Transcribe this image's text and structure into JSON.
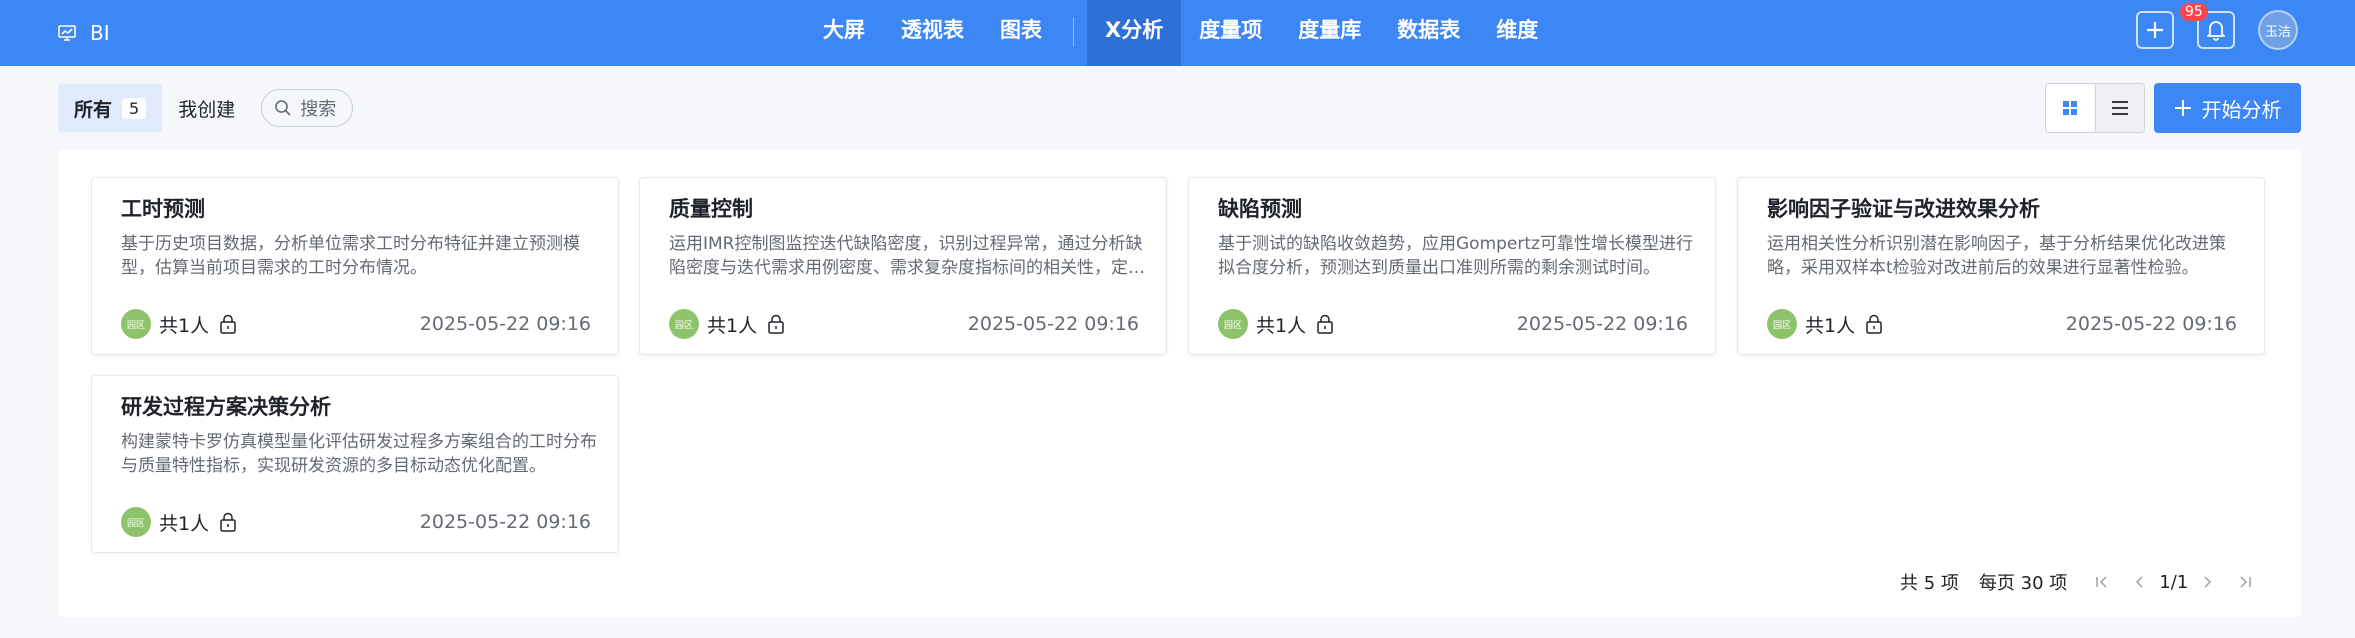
{
  "app": {
    "brand": "BI",
    "brand_icon": "monitor-chart-icon"
  },
  "nav": {
    "items": [
      {
        "label": "大屏"
      },
      {
        "label": "透视表"
      },
      {
        "label": "图表"
      },
      {
        "label": "X分析",
        "active": true
      },
      {
        "label": "度量项"
      },
      {
        "label": "度量库"
      },
      {
        "label": "数据表"
      },
      {
        "label": "维度"
      }
    ],
    "notification_count": "95",
    "user_avatar_text": "玉洁"
  },
  "filter": {
    "all_label": "所有",
    "all_count": "5",
    "mine_label": "我创建",
    "search_placeholder": "搜索"
  },
  "toolbar": {
    "start_label": "开始分析"
  },
  "cards": [
    {
      "title": "工时预测",
      "desc": "基于历史项目数据，分析单位需求工时分布特征并建立预测模型，估算当前项目需求的工时分布情况。",
      "avatar": "园区",
      "shared": "共1人",
      "date": "2025-05-22 09:16"
    },
    {
      "title": "质量控制",
      "desc": "运用IMR控制图监控迭代缺陷密度，识别过程异常，通过分析缺陷密度与迭代需求用例密度、需求复杂度指标间的相关性，定位影响质量的关键因素。",
      "avatar": "园区",
      "shared": "共1人",
      "date": "2025-05-22 09:16"
    },
    {
      "title": "缺陷预测",
      "desc": "基于测试的缺陷收敛趋势，应用Gompertz可靠性增长模型进行拟合度分析，预测达到质量出口准则所需的剩余测试时间。",
      "avatar": "园区",
      "shared": "共1人",
      "date": "2025-05-22 09:16"
    },
    {
      "title": "影响因子验证与改进效果分析",
      "desc": "运用相关性分析识别潜在影响因子，基于分析结果优化改进策略，采用双样本t检验对改进前后的效果进行显著性检验。",
      "avatar": "园区",
      "shared": "共1人",
      "date": "2025-05-22 09:16"
    },
    {
      "title": "研发过程方案决策分析",
      "desc": "构建蒙特卡罗仿真模型量化评估研发过程多方案组合的工时分布与质量特性指标，实现研发资源的多目标动态优化配置。",
      "avatar": "园区",
      "shared": "共1人",
      "date": "2025-05-22 09:16"
    }
  ],
  "pagination": {
    "total": "共 5 项",
    "per_page": "每页 30 项",
    "page": "1/1"
  },
  "colors": {
    "primary": "#3d86f5",
    "nav_active": "#2f6fd8",
    "badge": "#f5474c",
    "avatar_green": "#8fc36b"
  }
}
